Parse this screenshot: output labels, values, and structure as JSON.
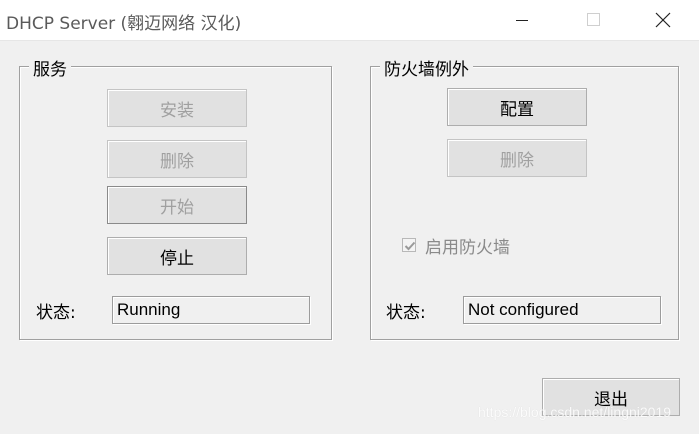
{
  "window": {
    "title": "DHCP Server (翱迈网络 汉化)",
    "controls": {
      "minimize_icon": "minimize-icon",
      "maximize_icon": "maximize-icon",
      "close_icon": "close-icon"
    }
  },
  "service_group": {
    "label": "服务",
    "install_label": "安装",
    "delete_label": "删除",
    "start_label": "开始",
    "stop_label": "停止",
    "status_label": "状态:",
    "status_value": "Running"
  },
  "firewall_group": {
    "label": "防火墙例外",
    "configure_label": "配置",
    "delete_label": "删除",
    "enable_checkbox_label": "启用防火墙",
    "enable_checkbox_checked": true,
    "status_label": "状态:",
    "status_value": "Not configured"
  },
  "exit_label": "退出",
  "watermark": "https://blog.csdn.net/lingni2019",
  "colors": {
    "titlebar": "#ffffff",
    "dialog_bg": "#f0f0f0",
    "disabled_text": "#a0a0a0"
  }
}
